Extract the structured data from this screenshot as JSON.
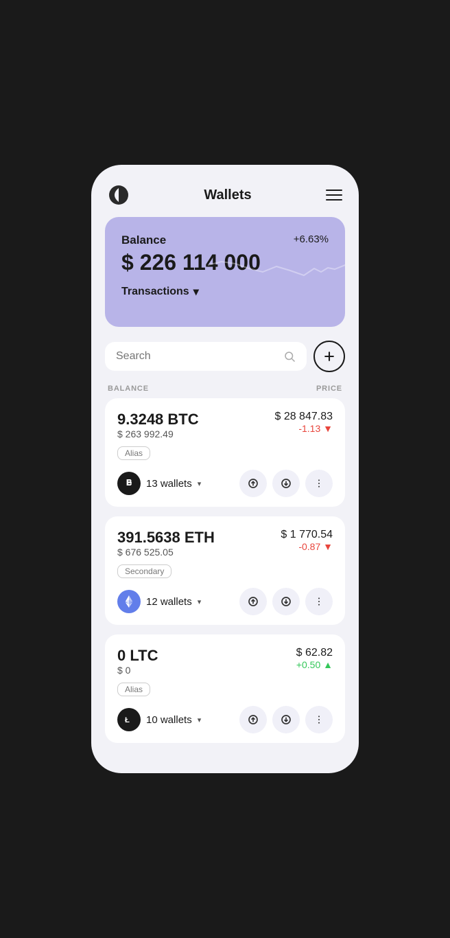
{
  "app": {
    "title": "Wallets"
  },
  "header": {
    "title": "Wallets",
    "menu_label": "Menu"
  },
  "balance_card": {
    "label": "Balance",
    "percent": "+6.63%",
    "amount": "$ 226 114 000",
    "transactions_label": "Transactions"
  },
  "search": {
    "placeholder": "Search"
  },
  "list_headers": {
    "balance": "BALANCE",
    "price": "PRICE"
  },
  "coins": [
    {
      "amount": "9.3248 BTC",
      "value": "$ 263 992.49",
      "tag": "Alias",
      "price": "$ 28 847.83",
      "change": "-1.13",
      "change_sign": "negative",
      "wallets": "13 wallets",
      "symbol": "BTC"
    },
    {
      "amount": "391.5638 ETH",
      "value": "$ 676 525.05",
      "tag": "Secondary",
      "price": "$ 1 770.54",
      "change": "-0.87",
      "change_sign": "negative",
      "wallets": "12 wallets",
      "symbol": "ETH"
    },
    {
      "amount": "0 LTC",
      "value": "$ 0",
      "tag": "Alias",
      "price": "$ 62.82",
      "change": "+0.50",
      "change_sign": "positive",
      "wallets": "10 wallets",
      "symbol": "LTC"
    }
  ],
  "actions": {
    "send": "↑",
    "receive": "↓",
    "more": "⋮"
  }
}
